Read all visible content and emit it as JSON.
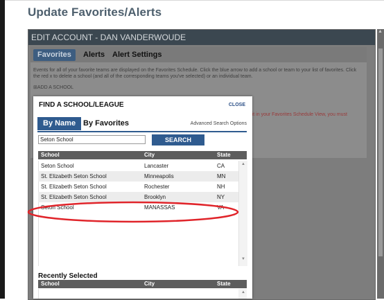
{
  "page": {
    "title": "Update Favorites/Alerts"
  },
  "account": {
    "header": "EDIT ACCOUNT - DAN VANDERWOUDE",
    "tabs": [
      "Favorites",
      "Alerts",
      "Alert Settings"
    ],
    "description": "Events for all of your favorite teams are displayed on the Favorites Schedule. Click the blue arrow to add a school or team to your list of favorites. Click the red x to delete a school (and all of the corresponding teams you've selected) or an individual team.",
    "add_school": "⊞ADD A SCHOOL",
    "note": "de it in your Favorites Schedule View, you must"
  },
  "modal": {
    "title": "FIND A SCHOOL/LEAGUE",
    "close": "CLOSE",
    "tab_by_name": "By Name",
    "tab_by_favorites": "By Favorites",
    "advanced_link": "Advanced Search Options",
    "search_value": "Seton School",
    "search_button": "SEARCH",
    "columns": {
      "school": "School",
      "city": "City",
      "state": "State"
    },
    "results": [
      {
        "school": "Seton School",
        "city": "Lancaster",
        "state": "CA"
      },
      {
        "school": "St. Elizabeth Seton School",
        "city": "Minneapolis",
        "state": "MN"
      },
      {
        "school": "St. Elizabeth Seton School",
        "city": "Rochester",
        "state": "NH"
      },
      {
        "school": "St. Elizabeth Seton School",
        "city": "Brooklyn",
        "state": "NY"
      },
      {
        "school": "Seton School",
        "city": "MANASSAS",
        "state": "VA"
      }
    ],
    "recent_title": "Recently Selected",
    "recent_columns": {
      "school": "School",
      "city": "City",
      "state": "State"
    }
  },
  "colors": {
    "brand_blue": "#2f5b8f",
    "header_dark": "#3b4750",
    "annotation_red": "#e0242a"
  }
}
